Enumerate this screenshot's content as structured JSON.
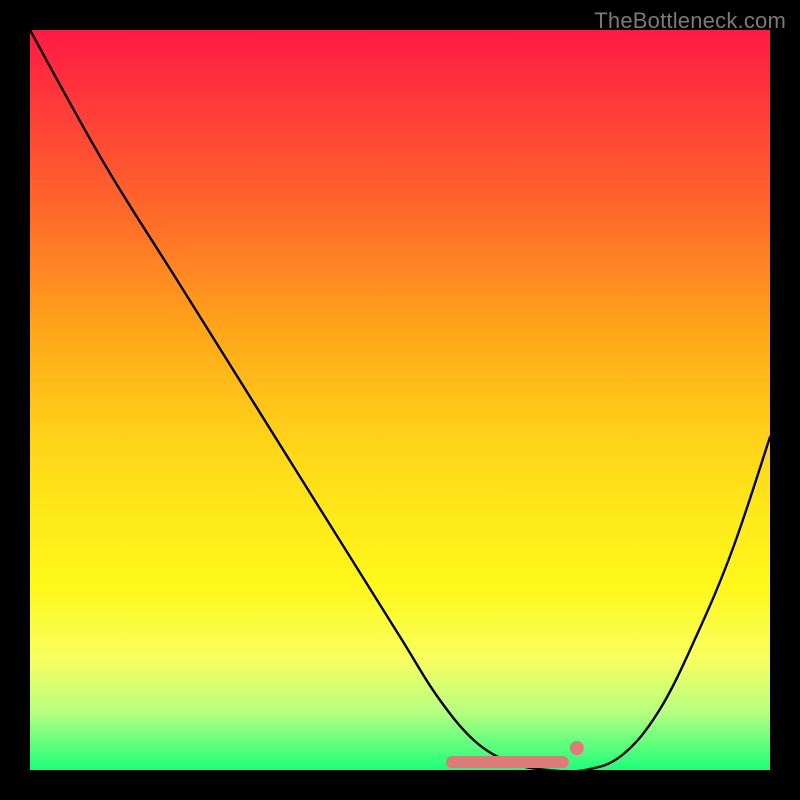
{
  "watermark": "TheBottleneck.com",
  "chart_data": {
    "type": "line",
    "title": "",
    "xlabel": "",
    "ylabel": "",
    "xlim": [
      0,
      100
    ],
    "ylim": [
      0,
      100
    ],
    "series": [
      {
        "name": "bottleneck-curve",
        "x": [
          0,
          10,
          20,
          30,
          40,
          50,
          55,
          60,
          65,
          70,
          75,
          80,
          85,
          90,
          95,
          100
        ],
        "values": [
          100,
          82,
          66,
          50,
          34,
          18,
          10,
          4,
          1,
          0,
          0,
          2,
          8,
          18,
          30,
          45
        ]
      }
    ],
    "highlight": {
      "name": "sweet-spot",
      "x_start": 57,
      "x_end": 72,
      "color": "#e07a7a"
    },
    "gradient_stops": [
      {
        "pos": 0,
        "color": "#ff1a44"
      },
      {
        "pos": 25,
        "color": "#ff6a2a"
      },
      {
        "pos": 55,
        "color": "#ffd21a"
      },
      {
        "pos": 85,
        "color": "#f8ff60"
      },
      {
        "pos": 100,
        "color": "#1aff7a"
      }
    ]
  }
}
